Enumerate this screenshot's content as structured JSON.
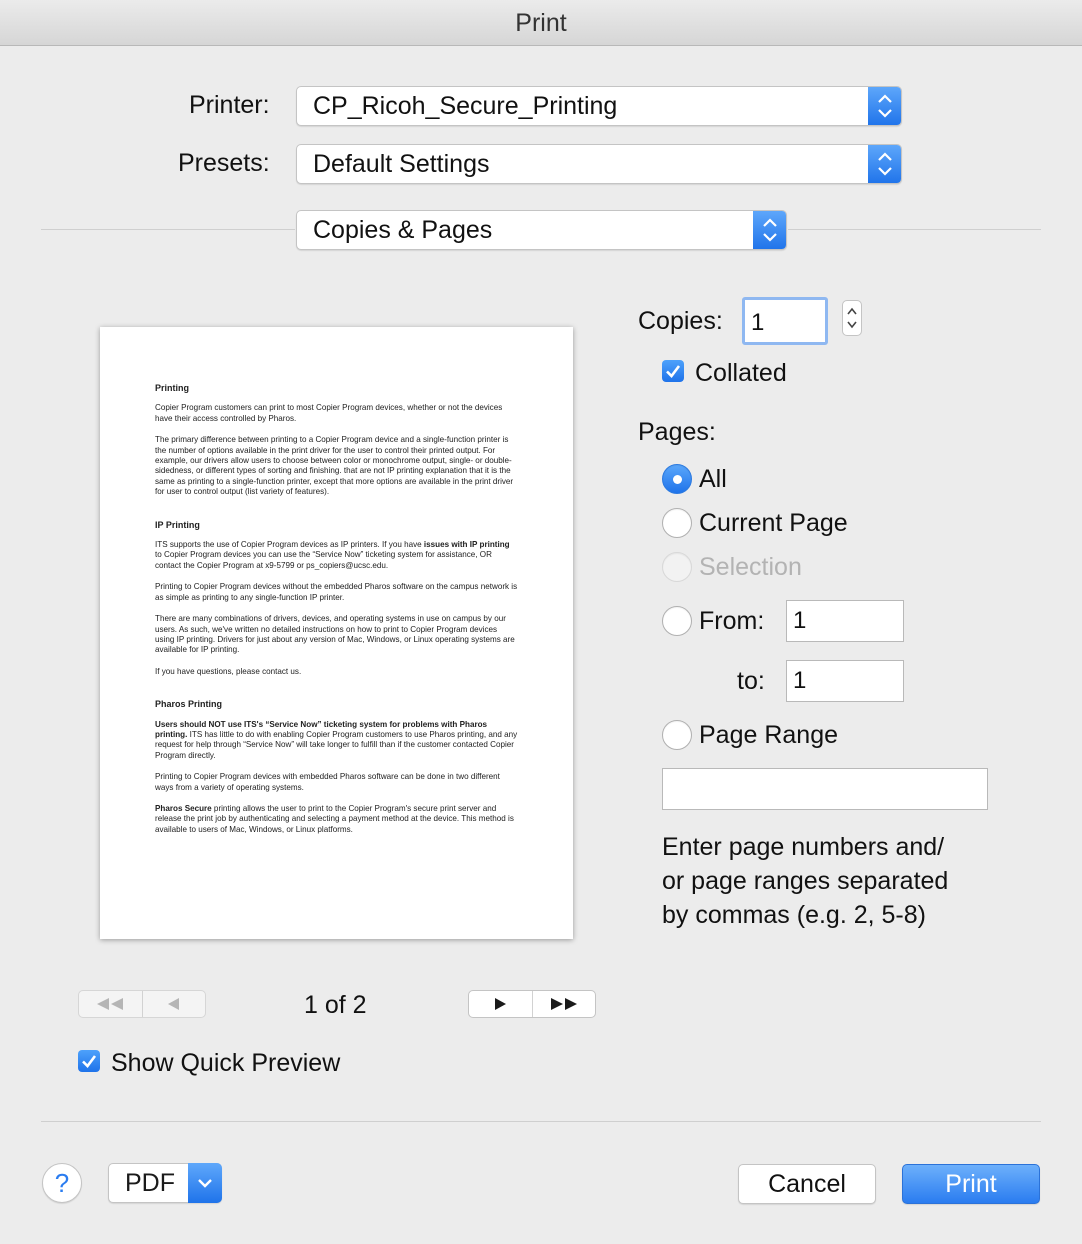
{
  "window": {
    "title": "Print"
  },
  "printer": {
    "label": "Printer:",
    "value": "CP_Ricoh_Secure_Printing"
  },
  "presets": {
    "label": "Presets:",
    "value": "Default Settings"
  },
  "panel": {
    "value": "Copies & Pages"
  },
  "copies": {
    "label": "Copies:",
    "value": "1",
    "collated_label": "Collated",
    "collated": true
  },
  "pages": {
    "label": "Pages:",
    "all": "All",
    "current_page": "Current Page",
    "selection": "Selection",
    "from_label": "From:",
    "from_value": "1",
    "to_label": "to:",
    "to_value": "1",
    "page_range": "Page Range",
    "page_range_value": "",
    "hint": [
      "Enter page numbers and/",
      "or page ranges separated",
      "by commas (e.g. 2, 5-8)"
    ],
    "selected": "all"
  },
  "preview": {
    "doc": {
      "h1": "Printing",
      "p1": "Copier Program customers can print to most Copier Program devices, whether or not the devices have their access controlled by Pharos.",
      "p2": "The primary difference between printing to a Copier Program device and a single-function printer is the number of options available in the print driver for the user to control their printed output. For example, our drivers allow users to choose between color or monochrome output, single- or double-sidedness, or different types of sorting and finishing. that are not IP printing explanation that it is the same as printing to a single-function printer, except that more options are available in the print driver for user to control output (list variety of features).",
      "h2": "IP Printing",
      "p3a": "ITS supports the use of Copier Program devices as IP printers. If you have ",
      "p3b": "issues with IP printing",
      "p3c": " to Copier Program devices you can use the “Service Now” ticketing system for assistance, OR contact the Copier Program at x9-5799 or ps_copiers@ucsc.edu.",
      "p4": "Printing to Copier Program devices without the embedded Pharos software on the campus network is as simple as printing to any single-function IP printer.",
      "p5": "There are many combinations of drivers, devices, and operating systems in use on campus by our users. As such, we've written no detailed instructions on how to print to Copier Program devices using IP printing. Drivers for just about any version of Mac, Windows, or Linux operating systems are available for IP printing.",
      "p6": "If you have questions, please contact us.",
      "h3": "Pharos Printing",
      "p7a": "Users should NOT use ITS's “Service Now” ticketing system for problems with Pharos printing.",
      "p7b": " ITS has little to do with enabling Copier Program customers to use Pharos printing, and any request for help through “Service Now” will take longer to fulfill than if the customer contacted Copier Program directly.",
      "p8": "Printing to Copier Program devices with embedded Pharos software can be done in two different ways from a variety of operating systems.",
      "p9a": "Pharos Secure",
      "p9b": " printing allows the user to print to the Copier Program's secure print server and release the print job by authenticating and selecting a payment method at the device. This method is available to users of Mac, Windows, or Linux platforms."
    },
    "page_indicator": "1 of 2",
    "show_quick_preview_label": "Show Quick Preview",
    "show_quick_preview": true
  },
  "footer": {
    "help": "?",
    "pdf": "PDF",
    "cancel": "Cancel",
    "print": "Print"
  },
  "colors": {
    "accent": "#2a7cf0",
    "window_bg": "#ececec"
  },
  "icons": [
    "stepper-arrows-icon",
    "checkmark-icon",
    "first-page-icon",
    "previous-page-icon",
    "next-page-icon",
    "last-page-icon",
    "chevron-down-icon",
    "help-icon"
  ]
}
